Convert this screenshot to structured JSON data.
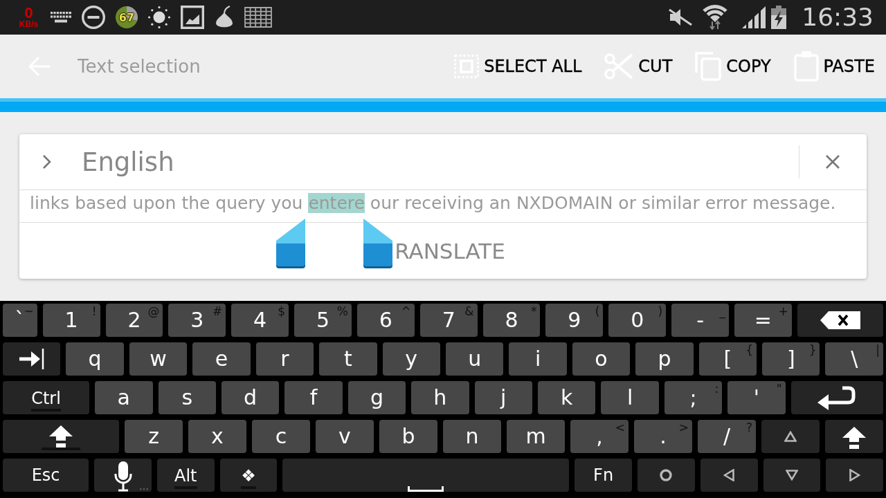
{
  "status_bar": {
    "net_speed": {
      "value": "0",
      "unit": "KB/s"
    },
    "ring_badge": {
      "text": "67"
    },
    "time": "16:33"
  },
  "action_bar": {
    "title": "Text selection",
    "actions": [
      {
        "kind": "select_all",
        "label": "SELECT ALL"
      },
      {
        "kind": "cut",
        "label": "CUT"
      },
      {
        "kind": "copy",
        "label": "COPY"
      },
      {
        "kind": "paste",
        "label": "PASTE"
      }
    ]
  },
  "card": {
    "language": "English",
    "text": [
      {
        "text": "links based upon the query you ",
        "selected": false
      },
      {
        "text": "entere",
        "selected": true
      },
      {
        "text": " our receiving an NXDOMAIN or similar error message.",
        "selected": false
      }
    ],
    "button": "RANSLATE"
  },
  "keyboard": {
    "rows": [
      {
        "keys": [
          {
            "kind": "char",
            "label": "`",
            "alt": "~"
          },
          {
            "kind": "char",
            "label": "1",
            "alt": "!"
          },
          {
            "kind": "char",
            "label": "2",
            "alt": "@"
          },
          {
            "kind": "char",
            "label": "3",
            "alt": "#"
          },
          {
            "kind": "char",
            "label": "4",
            "alt": "$"
          },
          {
            "kind": "char",
            "label": "5",
            "alt": "%"
          },
          {
            "kind": "char",
            "label": "6",
            "alt": "^"
          },
          {
            "kind": "char",
            "label": "7",
            "alt": "&"
          },
          {
            "kind": "char",
            "label": "8",
            "alt": "*"
          },
          {
            "kind": "char",
            "label": "9",
            "alt": "("
          },
          {
            "kind": "char",
            "label": "0",
            "alt": ")"
          },
          {
            "kind": "char",
            "label": "-",
            "alt": "_"
          },
          {
            "kind": "char",
            "label": "=",
            "alt": "+"
          },
          {
            "kind": "backspace"
          }
        ]
      },
      {
        "keys": [
          {
            "kind": "tab"
          },
          {
            "kind": "char",
            "label": "q"
          },
          {
            "kind": "char",
            "label": "w"
          },
          {
            "kind": "char",
            "label": "e"
          },
          {
            "kind": "char",
            "label": "r"
          },
          {
            "kind": "char",
            "label": "t"
          },
          {
            "kind": "char",
            "label": "y"
          },
          {
            "kind": "char",
            "label": "u"
          },
          {
            "kind": "char",
            "label": "i"
          },
          {
            "kind": "char",
            "label": "o"
          },
          {
            "kind": "char",
            "label": "p"
          },
          {
            "kind": "char",
            "label": "[",
            "alt": "{"
          },
          {
            "kind": "char",
            "label": "]",
            "alt": "}"
          },
          {
            "kind": "char",
            "label": "\\",
            "alt": "|"
          }
        ]
      },
      {
        "keys": [
          {
            "kind": "mod",
            "label": "Ctrl",
            "on": false
          },
          {
            "kind": "char",
            "label": "a"
          },
          {
            "kind": "char",
            "label": "s"
          },
          {
            "kind": "char",
            "label": "d"
          },
          {
            "kind": "char",
            "label": "f"
          },
          {
            "kind": "char",
            "label": "g"
          },
          {
            "kind": "char",
            "label": "h"
          },
          {
            "kind": "char",
            "label": "j"
          },
          {
            "kind": "char",
            "label": "k"
          },
          {
            "kind": "char",
            "label": "l"
          },
          {
            "kind": "char",
            "label": ";",
            "alt": ":"
          },
          {
            "kind": "char",
            "label": "'",
            "alt": "\""
          },
          {
            "kind": "enter"
          }
        ]
      },
      {
        "keys": [
          {
            "kind": "shift",
            "on": false
          },
          {
            "kind": "char",
            "label": "z"
          },
          {
            "kind": "char",
            "label": "x"
          },
          {
            "kind": "char",
            "label": "c"
          },
          {
            "kind": "char",
            "label": "v"
          },
          {
            "kind": "char",
            "label": "b"
          },
          {
            "kind": "char",
            "label": "n"
          },
          {
            "kind": "char",
            "label": "m"
          },
          {
            "kind": "char",
            "label": ",",
            "alt": "<"
          },
          {
            "kind": "char",
            "label": ".",
            "alt": ">"
          },
          {
            "kind": "char",
            "label": "/",
            "alt": "?"
          },
          {
            "kind": "up"
          },
          {
            "kind": "shift"
          }
        ]
      },
      {
        "keys": [
          {
            "kind": "func",
            "label": "Esc"
          },
          {
            "kind": "mic",
            "hint": "…"
          },
          {
            "kind": "mod",
            "label": "Alt",
            "on": false
          },
          {
            "kind": "mod",
            "label": "❖",
            "on": false
          },
          {
            "kind": "space"
          },
          {
            "kind": "func",
            "label": "Fn"
          },
          {
            "kind": "circle"
          },
          {
            "kind": "left"
          },
          {
            "kind": "down"
          },
          {
            "kind": "right"
          }
        ]
      }
    ]
  }
}
